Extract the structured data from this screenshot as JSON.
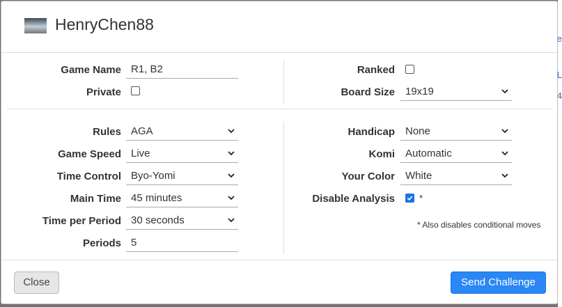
{
  "header": {
    "username": "HenryChen88"
  },
  "left_top": {
    "game_name_label": "Game Name",
    "game_name_value": "R1, B2",
    "private_label": "Private",
    "private_checked": false
  },
  "right_top": {
    "ranked_label": "Ranked",
    "ranked_checked": false,
    "board_size_label": "Board Size",
    "board_size_value": "19x19"
  },
  "left_main": {
    "rules_label": "Rules",
    "rules_value": "AGA",
    "game_speed_label": "Game Speed",
    "game_speed_value": "Live",
    "time_control_label": "Time Control",
    "time_control_value": "Byo-Yomi",
    "main_time_label": "Main Time",
    "main_time_value": "45 minutes",
    "time_per_period_label": "Time per Period",
    "time_per_period_value": "30 seconds",
    "periods_label": "Periods",
    "periods_value": "5"
  },
  "right_main": {
    "handicap_label": "Handicap",
    "handicap_value": "None",
    "komi_label": "Komi",
    "komi_value": "Automatic",
    "your_color_label": "Your Color",
    "your_color_value": "White",
    "disable_analysis_label": "Disable Analysis",
    "disable_analysis_checked": true,
    "disable_analysis_star": "*",
    "footnote": "* Also disables conditional moves"
  },
  "footer": {
    "close_label": "Close",
    "send_label": "Send Challenge"
  },
  "colors": {
    "primary": "#2a87f5",
    "checkbox": "#1a73e8"
  }
}
